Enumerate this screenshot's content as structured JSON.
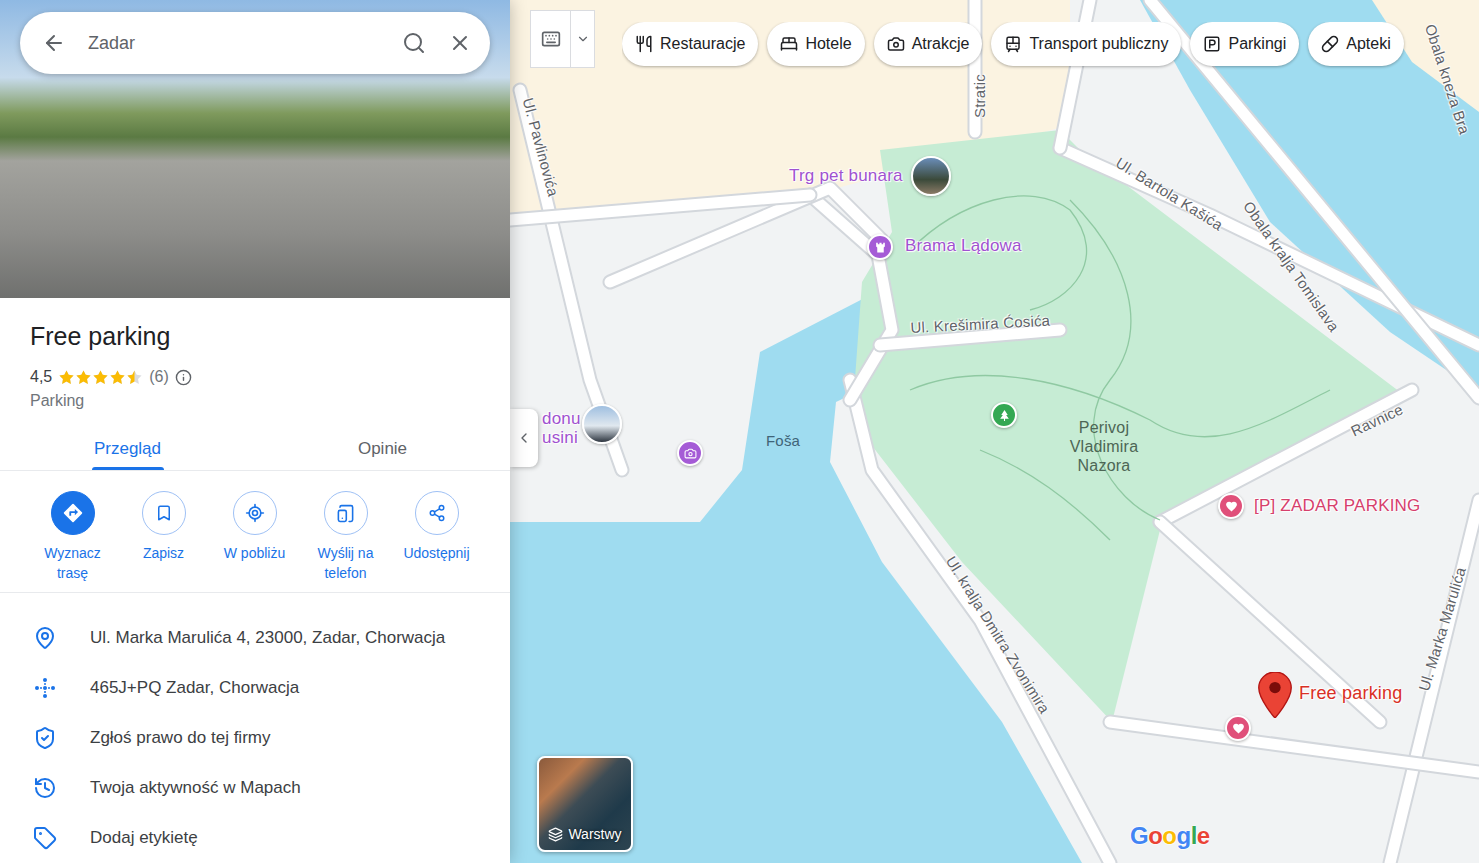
{
  "search": {
    "value": "Zadar"
  },
  "place": {
    "title": "Free parking",
    "rating": "4,5",
    "stars": 4.5,
    "review_count": "(6)",
    "category": "Parking"
  },
  "tabs": [
    {
      "label": "Przegląd",
      "selected": true
    },
    {
      "label": "Opinie",
      "selected": false
    }
  ],
  "actions": [
    {
      "label": "Wyznacz trasę",
      "kind": "directions",
      "primary": true
    },
    {
      "label": "Zapisz",
      "kind": "save",
      "primary": false
    },
    {
      "label": "W pobliżu",
      "kind": "nearby",
      "primary": false
    },
    {
      "label": "Wyślij na telefon",
      "kind": "phone",
      "primary": false
    },
    {
      "label": "Udostępnij",
      "kind": "share",
      "primary": false
    }
  ],
  "info": [
    {
      "text": "Ul. Marka Marulića 4, 23000, Zadar, Chorwacja",
      "kind": "address"
    },
    {
      "text": "465J+PQ Zadar, Chorwacja",
      "kind": "pluscode"
    },
    {
      "text": "Zgłoś prawo do tej firmy",
      "kind": "claim"
    },
    {
      "text": "Twoja aktywność w Mapach",
      "kind": "activity"
    },
    {
      "text": "Dodaj etykietę",
      "kind": "label"
    }
  ],
  "chips": [
    {
      "label": "Restauracje",
      "kind": "restaurants"
    },
    {
      "label": "Hotele",
      "kind": "hotels"
    },
    {
      "label": "Atrakcje",
      "kind": "attractions"
    },
    {
      "label": "Transport publiczny",
      "kind": "transit"
    },
    {
      "label": "Parkingi",
      "kind": "parking"
    },
    {
      "label": "Apteki",
      "kind": "pharmacy"
    }
  ],
  "map": {
    "labels": [
      {
        "text": "Stratic",
        "kind": "street"
      },
      {
        "text": "Ul. Pavlinovića",
        "kind": "street"
      },
      {
        "text": "Trg pet bunara",
        "kind": "poi"
      },
      {
        "text": "Brama Lądowa",
        "kind": "poi"
      },
      {
        "text": "Ul. Krešimira Ćosića",
        "kind": "street"
      },
      {
        "text": "Ul. Bartola Kašića",
        "kind": "street"
      },
      {
        "text": "Obala kralja Tomislava",
        "kind": "street"
      },
      {
        "text": "Obala kneza Bra",
        "kind": "street"
      },
      {
        "text": "Ravnice",
        "kind": "street"
      },
      {
        "text": "Perivoj Vladimira Nazora",
        "kind": "park"
      },
      {
        "text": "[P] ZADAR PARKING",
        "kind": "parking"
      },
      {
        "text": "Free parking",
        "kind": "selected"
      },
      {
        "text": "Foša",
        "kind": "water"
      },
      {
        "text": "Ul. kralja Dmitra Zvonimira",
        "kind": "street"
      },
      {
        "text": "Ul. Marka Marulića",
        "kind": "street"
      },
      {
        "text": "donu",
        "kind": "poi"
      },
      {
        "text": "usini",
        "kind": "poi"
      }
    ]
  },
  "layers": {
    "label": "Warstwy"
  },
  "logo": "Google"
}
